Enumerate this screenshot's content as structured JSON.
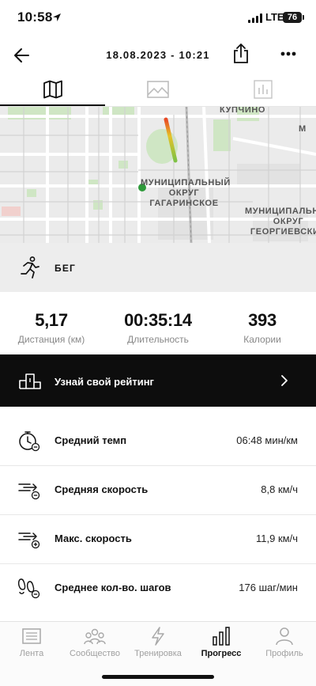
{
  "status_bar": {
    "time": "10:58",
    "network": "LTE",
    "battery": "76"
  },
  "header": {
    "title": "18.08.2023 - 10:21"
  },
  "tabs": [
    {
      "name": "map",
      "icon": "map-icon",
      "active": true
    },
    {
      "name": "photos",
      "icon": "image-icon",
      "active": false
    },
    {
      "name": "stats",
      "icon": "bar-chart-icon",
      "active": false
    }
  ],
  "map": {
    "labels": {
      "kupchino": "КУПЧИНО",
      "district_1": [
        "МУНИЦИПАЛЬНЫЙ",
        "ОКРУГ",
        "ГАГАРИНСКОЕ"
      ],
      "district_2": [
        "МУНИЦИПАЛЬНЫЙ",
        "ОКРУГ",
        "ГЕОРГИЕВСКИЙ"
      ],
      "edge_m": "М"
    }
  },
  "activity": {
    "label": "БЕГ",
    "icon": "runner-icon"
  },
  "stats": [
    {
      "value": "5,17",
      "label": "Дистанция (км)"
    },
    {
      "value": "00:35:14",
      "label": "Длительность"
    },
    {
      "value": "393",
      "label": "Калории"
    }
  ],
  "rating": {
    "label": "Узнай свой рейтинг",
    "icon": "podium-icon"
  },
  "metrics": [
    {
      "label": "Средний темп",
      "value": "06:48 мин/км",
      "icon": "stopwatch-icon"
    },
    {
      "label": "Средняя скорость",
      "value": "8,8 км/ч",
      "icon": "speed-minus-icon"
    },
    {
      "label": "Макс. скорость",
      "value": "11,9 км/ч",
      "icon": "speed-plus-icon"
    },
    {
      "label": "Среднее кол-во. шагов",
      "value": "176 шаг/мин",
      "icon": "footsteps-icon"
    }
  ],
  "nav": [
    {
      "label": "Лента",
      "icon": "feed-icon",
      "active": false
    },
    {
      "label": "Сообщество",
      "icon": "community-icon",
      "active": false
    },
    {
      "label": "Тренировка",
      "icon": "lightning-icon",
      "active": false
    },
    {
      "label": "Прогресс",
      "icon": "progress-icon",
      "active": true
    },
    {
      "label": "Профиль",
      "icon": "profile-icon",
      "active": false
    }
  ],
  "colors": {
    "accent": "#0d0d0d",
    "route_start": "#2e9a3a",
    "route_hot": "#e84a26",
    "route_warm": "#e6c229",
    "park": "#cfe6c4"
  }
}
